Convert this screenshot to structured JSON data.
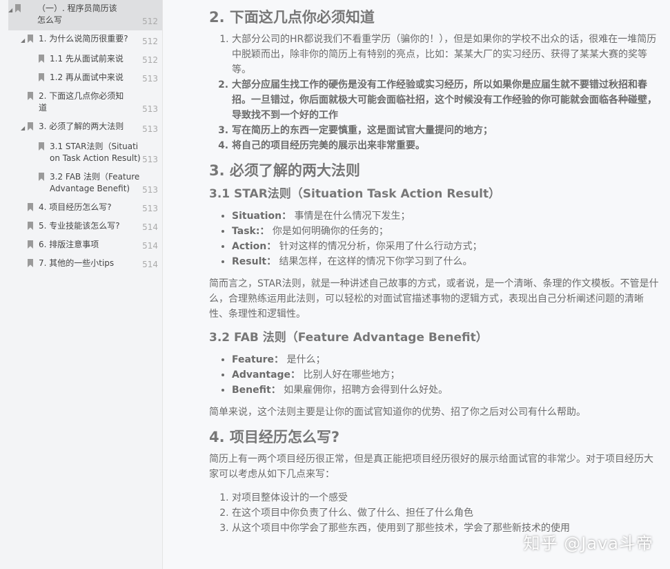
{
  "toc": [
    {
      "label": "（一）. 程序员简历该怎么写",
      "page": "512",
      "level": 0,
      "tri": true,
      "sel": true
    },
    {
      "label": "1. 为什么说简历很重要?",
      "page": "512",
      "level": 1,
      "tri": true
    },
    {
      "label": "1.1 先从面试前来说",
      "page": "512",
      "level": 2
    },
    {
      "label": "1.2 再从面试中来说",
      "page": "513",
      "level": 2
    },
    {
      "label": "2. 下面这几点你必须知道",
      "page": "513",
      "level": 1
    },
    {
      "label": "3. 必须了解的两大法则",
      "page": "513",
      "level": 1,
      "tri": true
    },
    {
      "label": "3.1 STAR法则（Situation Task Action Result)",
      "page": "513",
      "level": 2
    },
    {
      "label": "3.2 FAB 法则（Feature Advantage Benefit)",
      "page": "513",
      "level": 2
    },
    {
      "label": "4. 项目经历怎么写?",
      "page": "513",
      "level": 1
    },
    {
      "label": "5. 专业技能该怎么写?",
      "page": "514",
      "level": 1
    },
    {
      "label": "6. 排版注意事项",
      "page": "514",
      "level": 1
    },
    {
      "label": "7. 其他的一些小tips",
      "page": "514",
      "level": 1
    }
  ],
  "content": {
    "h2_know": "2. 下面这几点你必须知道",
    "know_items": [
      "大部分公司的HR都说我们不看重学历（骗你的！），但是如果你的学校不出众的话，很难在一堆简历中脱颖而出，除非你的简历上有特别的亮点，比如：某某大厂的实习经历、获得了某某大赛的奖等等。",
      "大部分应届生找工作的硬伤是没有工作经验或实习经历，所以如果你是应届生就不要错过秋招和春招。一旦错过，你后面就极大可能会面临社招，这个时候没有工作经验的你可能就会面临各种碰壁，导致找不到一个好的工作",
      "写在简历上的东西一定要慎重，这是面试官大量提问的地方；",
      "将自己的项目经历完美的展示出来非常重要。"
    ],
    "h2_rules": "3. 必须了解的两大法则",
    "h3_star": "3.1 STAR法则（Situation Task Action Result）",
    "star": [
      {
        "k": "Situation：",
        "v": "事情是在什么情况下发生；"
      },
      {
        "k": "Task:：",
        "v": "你是如何明确你的任务的；"
      },
      {
        "k": "Action：",
        "v": "针对这样的情况分析，你采用了什么行动方式；"
      },
      {
        "k": "Result：",
        "v": "结果怎样，在这样的情况下你学习到了什么。"
      }
    ],
    "star_p": "简而言之，STAR法则，就是一种讲述自己故事的方式，或者说，是一个清晰、条理的作文模板。不管是什么，合理熟练运用此法则，可以轻松的对面试官描述事物的逻辑方式，表现出自己分析阐述问题的清晰性、条理性和逻辑性。",
    "h3_fab": "3.2 FAB 法则（Feature Advantage Benefit）",
    "fab": [
      {
        "k": "Feature：",
        "v": "是什么；"
      },
      {
        "k": "Advantage：",
        "v": "比别人好在哪些地方；"
      },
      {
        "k": "Benefit：",
        "v": "如果雇佣你，招聘方会得到什么好处。"
      }
    ],
    "fab_p": "简单来说，这个法则主要是让你的面试官知道你的优势、招了你之后对公司有什么帮助。",
    "h2_proj": "4. 项目经历怎么写?",
    "proj_p": "简历上有一两个项目经历很正常，但是真正能把项目经历很好的展示给面试官的非常少。对于项目经历大家可以考虑从如下几点来写：",
    "proj_items": [
      "对项目整体设计的一个感受",
      "在这个项目中你负责了什么、做了什么、担任了什么角色",
      "从这个项目中你学会了那些东西，使用到了那些技术，学会了那些新技术的使用"
    ]
  },
  "watermark": "知乎 @Java斗帝"
}
